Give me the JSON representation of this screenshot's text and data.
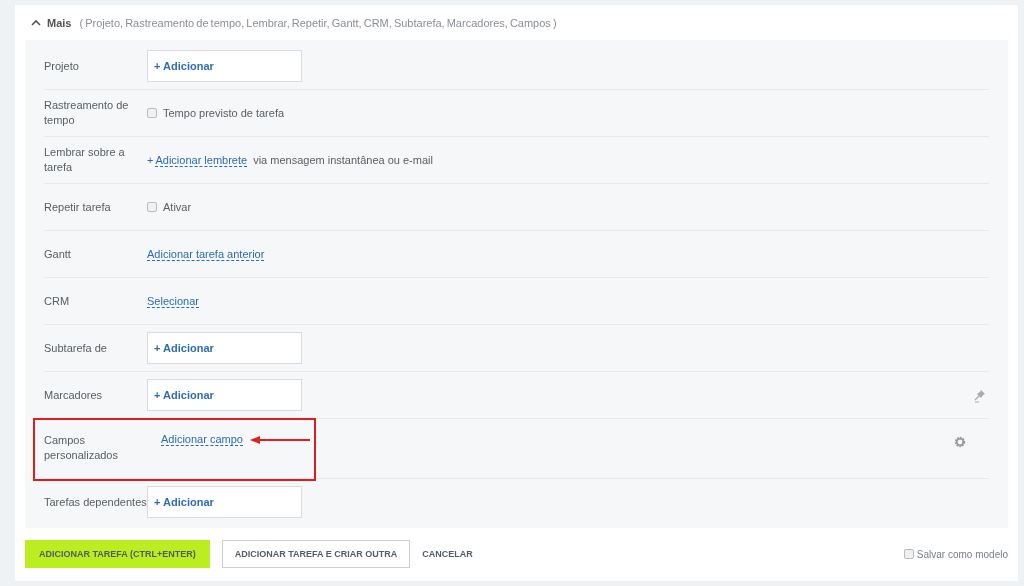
{
  "section": {
    "title": "Mais",
    "expanded": true,
    "summary": "( Projeto,  Rastreamento de tempo,  Lembrar,  Repetir,  Gantt,  CRM,  Subtarefa,  Marcadores,  Campos )"
  },
  "rows": [
    {
      "kind": "picker",
      "label": "Projeto",
      "button": "+ Adicionar"
    },
    {
      "kind": "checkbox",
      "label": "Rastreamento de tempo",
      "option": "Tempo previsto de tarefa",
      "checked": false
    },
    {
      "kind": "reminder",
      "label": "Lembrar sobre a tarefa",
      "prefix": "+",
      "link": "Adicionar lembrete",
      "suffix": "via mensagem instantânea ou e-mail"
    },
    {
      "kind": "checkbox",
      "label": "Repetir tarefa",
      "option": "Ativar",
      "checked": false
    },
    {
      "kind": "link",
      "label": "Gantt",
      "link": "Adicionar tarefa anterior"
    },
    {
      "kind": "link",
      "label": "CRM",
      "link": "Selecionar"
    },
    {
      "kind": "picker",
      "label": "Subtarefa de",
      "button": "+ Adicionar"
    },
    {
      "kind": "picker",
      "label": "Marcadores",
      "button": "+ Adicionar",
      "pinned": true
    },
    {
      "kind": "custom",
      "label": "Campos personalizados",
      "link": "Adicionar campo",
      "annotated": true
    },
    {
      "kind": "picker",
      "label": "Tarefas dependentes",
      "button": "+ Adicionar"
    }
  ],
  "footer": {
    "primary": "ADICIONAR TAREFA (CTRL+ENTER)",
    "secondary": "ADICIONAR TAREFA E CRIAR OUTRA",
    "cancel": "CANCELAR",
    "template": {
      "label": "Salvar como modelo",
      "checked": false
    }
  }
}
